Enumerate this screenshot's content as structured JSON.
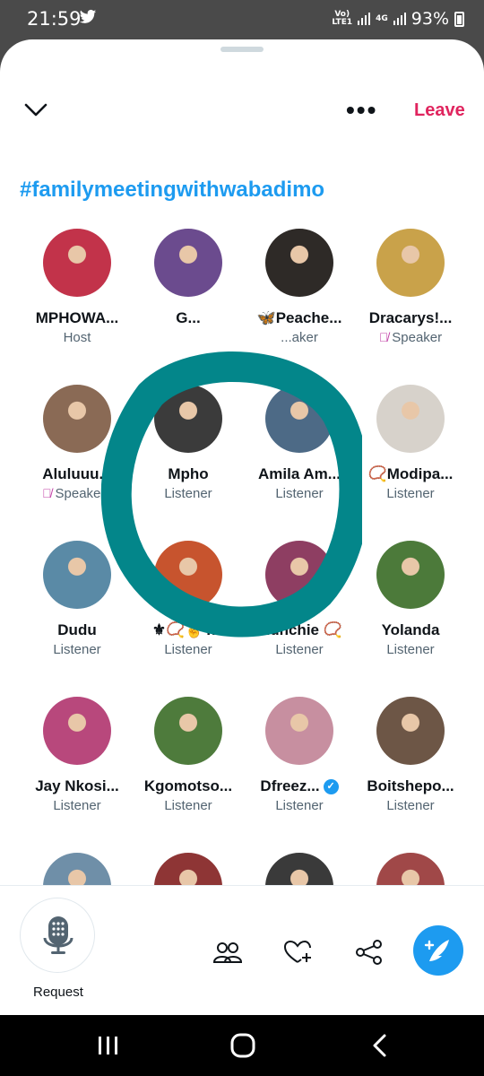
{
  "status": {
    "time": "21:59",
    "network_top": "Vo)",
    "network_bottom": "LTE1",
    "net_type": "4G",
    "battery": "93%"
  },
  "header": {
    "leave_label": "Leave",
    "more_icon": "more-icon",
    "collapse_icon": "chevron-down-icon"
  },
  "space": {
    "title": "#familymeetingwithwabadimo"
  },
  "participants": [
    {
      "name": "MPHOWA...",
      "role": "Host",
      "muted": false,
      "color": "#c2334a"
    },
    {
      "name": "G...",
      "role": "",
      "muted": false,
      "color": "#6b4b8e"
    },
    {
      "name": "🦋Peache...",
      "role": "...aker",
      "muted": false,
      "color": "#2e2a27"
    },
    {
      "name": "Dracarys!...",
      "role": "Speaker",
      "muted": true,
      "color": "#c9a24a"
    },
    {
      "name": "Aluluuu...",
      "role": "Speake...",
      "muted": true,
      "color": "#8a6a55"
    },
    {
      "name": "Mpho",
      "role": "Listener",
      "muted": false,
      "color": "#3b3b3b"
    },
    {
      "name": "Amila Am...",
      "role": "Listener",
      "muted": false,
      "color": "#4d6a86"
    },
    {
      "name": "📿Modipa...",
      "role": "Listener",
      "muted": false,
      "color": "#d7d2cb"
    },
    {
      "name": "Dudu",
      "role": "Listener",
      "muted": false,
      "color": "#5a8aa6"
    },
    {
      "name": "⚜📿✌T...",
      "role": "Listener",
      "muted": false,
      "color": "#c7542e"
    },
    {
      "name": "munchie 📿",
      "role": "Listener",
      "muted": false,
      "color": "#8e3e62"
    },
    {
      "name": "Yolanda",
      "role": "Listener",
      "muted": false,
      "color": "#4c7a3a"
    },
    {
      "name": "Jay Nkosi...",
      "role": "Listener",
      "muted": false,
      "color": "#b8487c"
    },
    {
      "name": "Kgomotso...",
      "role": "Listener",
      "muted": false,
      "color": "#4e7b3c"
    },
    {
      "name": "Dfreez...",
      "role": "Listener",
      "muted": false,
      "color": "#c78fa0",
      "verified": true
    },
    {
      "name": "Boitshepo...",
      "role": "Listener",
      "muted": false,
      "color": "#6d5646"
    },
    {
      "name": "",
      "role": "",
      "muted": false,
      "color": "#6f8fa8"
    },
    {
      "name": "",
      "role": "",
      "muted": false,
      "color": "#8e3535"
    },
    {
      "name": "",
      "role": "",
      "muted": false,
      "color": "#3a3a3a"
    },
    {
      "name": "",
      "role": "",
      "muted": false,
      "color": "#a04848"
    }
  ],
  "bottom": {
    "request_label": "Request"
  },
  "colors": {
    "accent": "#1d9bf0",
    "leave": "#e0245e",
    "highlight_circle": "#03868a"
  }
}
